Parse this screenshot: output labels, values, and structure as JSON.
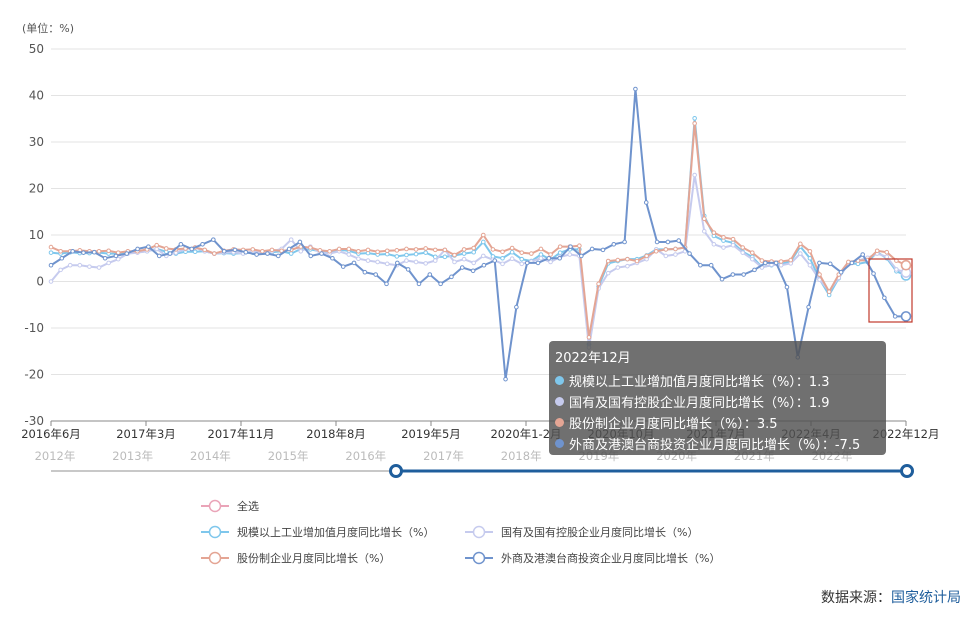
{
  "unit_label": "(单位：%)",
  "chart_data": {
    "type": "line",
    "ylim": [
      -30,
      50
    ],
    "yticks": [
      50,
      40,
      30,
      20,
      10,
      0,
      -10,
      -20,
      -30
    ],
    "x_axis_labels": [
      "2016年6月",
      "2017年3月",
      "2017年11月",
      "2018年8月",
      "2019年5月",
      "2020年1-2月",
      "2020年10月",
      "2021年7月",
      "2022年4月",
      "2022年12月"
    ],
    "slider_year_labels": [
      "2012年",
      "2013年",
      "2014年",
      "2015年",
      "2016年",
      "2017年",
      "2018年",
      "2019年",
      "2020年",
      "2021年",
      "2022年"
    ],
    "grid": true,
    "series": [
      {
        "name": "规模以上工业增加值月度同比增长（%）",
        "color": "#7fc7ec",
        "values": [
          6.2,
          6.0,
          6.3,
          6.1,
          6.1,
          6.2,
          6.0,
          6.0,
          6.1,
          6.3,
          6.5,
          7.0,
          6.4,
          6.0,
          6.4,
          6.4,
          6.5,
          6.0,
          6.1,
          6.0,
          6.1,
          6.2,
          6.4,
          6.3,
          6.5,
          6.0,
          7.0,
          6.9,
          6.5,
          6.0,
          6.8,
          6.6,
          6.0,
          6.1,
          5.8,
          5.9,
          5.4,
          5.7,
          5.9,
          6.2,
          5.3,
          5.3,
          5.6,
          6.0,
          6.3,
          8.5,
          5.4,
          5.0,
          6.3,
          4.8,
          4.4,
          5.8,
          4.7,
          6.2,
          6.9,
          6.9,
          -13.5,
          -1.1,
          3.9,
          4.4,
          4.8,
          4.8,
          5.6,
          6.9,
          6.9,
          7.0,
          7.3,
          35.1,
          14.1,
          9.8,
          8.8,
          8.3,
          6.4,
          5.3,
          3.1,
          3.5,
          3.8,
          4.3,
          7.5,
          5.0,
          0.5,
          -2.9,
          0.7,
          3.9,
          3.8,
          4.2,
          6.3,
          5.0,
          2.2,
          1.3
        ]
      },
      {
        "name": "国有及国有控股企业月度同比增长（%）",
        "color": "#c6cbee",
        "values": [
          0.0,
          2.5,
          3.5,
          3.5,
          3.2,
          3.0,
          4.0,
          4.8,
          6.0,
          6.2,
          6.5,
          7.0,
          5.5,
          6.2,
          7.0,
          7.3,
          6.5,
          6.0,
          6.2,
          6.3,
          6.0,
          6.5,
          6.2,
          6.5,
          7.0,
          9.0,
          6.5,
          7.5,
          6.2,
          6.0,
          6.5,
          5.8,
          4.9,
          4.5,
          4.2,
          3.8,
          3.5,
          4.5,
          4.2,
          3.9,
          4.5,
          6.8,
          4.2,
          4.8,
          4.0,
          5.5,
          4.7,
          3.8,
          4.9,
          3.8,
          4.3,
          5.0,
          4.2,
          5.3,
          5.8,
          5.5,
          -14.2,
          -1.5,
          1.8,
          3.0,
          3.3,
          4.0,
          4.8,
          6.9,
          5.5,
          5.8,
          6.5,
          22.9,
          10.8,
          8.0,
          7.3,
          7.8,
          6.2,
          4.8,
          3.0,
          3.6,
          3.5,
          3.9,
          6.0,
          3.5,
          0.4,
          -2.1,
          0.8,
          3.8,
          4.5,
          5.1,
          6.0,
          5.3,
          2.6,
          1.9
        ]
      },
      {
        "name": "股份制企业月度同比增长（%）",
        "color": "#e4a594",
        "values": [
          7.4,
          6.5,
          6.5,
          6.7,
          6.5,
          6.5,
          6.6,
          6.2,
          6.5,
          6.5,
          6.9,
          7.8,
          7.1,
          6.9,
          7.1,
          7.3,
          6.8,
          6.0,
          6.6,
          6.9,
          6.8,
          6.9,
          6.5,
          6.8,
          6.6,
          6.8,
          7.5,
          7.3,
          6.7,
          6.5,
          7.0,
          7.0,
          6.5,
          6.8,
          6.4,
          6.6,
          6.7,
          7.0,
          6.9,
          7.1,
          6.8,
          6.8,
          5.7,
          6.9,
          7.2,
          10.0,
          6.9,
          6.4,
          7.2,
          6.2,
          6.0,
          7.0,
          5.8,
          7.5,
          7.5,
          7.7,
          -12.0,
          -0.5,
          4.4,
          4.6,
          4.8,
          4.4,
          5.5,
          6.5,
          6.9,
          7.0,
          7.3,
          34.0,
          13.5,
          10.5,
          9.5,
          9.1,
          7.3,
          6.2,
          4.5,
          4.3,
          4.3,
          4.6,
          8.1,
          6.5,
          1.5,
          -2.2,
          1.5,
          4.2,
          4.5,
          4.6,
          6.6,
          6.3,
          4.5,
          3.5
        ]
      },
      {
        "name": "外商及港澳台商投资企业月度同比增长（%）",
        "color": "#6f93cd",
        "values": [
          3.5,
          5.0,
          6.5,
          6.2,
          6.3,
          5.0,
          5.5,
          6.0,
          7.0,
          7.5,
          5.5,
          6.0,
          8.0,
          7.0,
          8.0,
          9.0,
          6.5,
          6.8,
          6.3,
          5.8,
          6.0,
          5.5,
          7.0,
          8.5,
          5.5,
          6.0,
          5.0,
          3.2,
          4.0,
          2.0,
          1.5,
          -0.5,
          4.0,
          2.6,
          -0.5,
          1.5,
          -0.5,
          1.0,
          3.0,
          2.3,
          3.5,
          4.5,
          -21.0,
          -5.5,
          4.0,
          4.0,
          5.0,
          5.0,
          7.5,
          5.5,
          7.0,
          6.8,
          8.0,
          8.5,
          41.4,
          17.0,
          8.5,
          8.5,
          8.8,
          6.0,
          3.5,
          3.5,
          0.5,
          1.5,
          1.5,
          2.5,
          4.0,
          4.0,
          -1.2,
          -16.3,
          -5.5,
          4.0,
          3.8,
          2.0,
          4.0,
          5.8,
          1.7,
          -3.5,
          -7.5,
          -7.5
        ]
      }
    ]
  },
  "tooltip": {
    "title": "2022年12月",
    "rows": [
      {
        "text": "规模以上工业增加值月度同比增长（%）：1.3",
        "color": "#7fc7ec"
      },
      {
        "text": "国有及国有控股企业月度同比增长（%）：1.9",
        "color": "#c6cbee"
      },
      {
        "text": "股份制企业月度同比增长（%）：3.5",
        "color": "#e4a594"
      },
      {
        "text": "外商及港澳台商投资企业月度同比增长（%）：-7.5",
        "color": "#6f93cd"
      }
    ]
  },
  "legend": {
    "select_all": {
      "label": "全选",
      "color": "#eaa4b8"
    },
    "items": [
      {
        "label": "规模以上工业增加值月度同比增长（%）",
        "color": "#7fc7ec"
      },
      {
        "label": "国有及国有控股企业月度同比增长（%）",
        "color": "#c6cbee"
      },
      {
        "label": "股份制企业月度同比增长（%）",
        "color": "#e4a594"
      },
      {
        "label": "外商及港澳台商投资企业月度同比增长（%）",
        "color": "#6f93cd"
      }
    ]
  },
  "source": {
    "prefix": "数据来源：",
    "link": "国家统计局"
  },
  "colors": {
    "slider": "#1f5e9c",
    "highlight_box": "#c0392b"
  }
}
